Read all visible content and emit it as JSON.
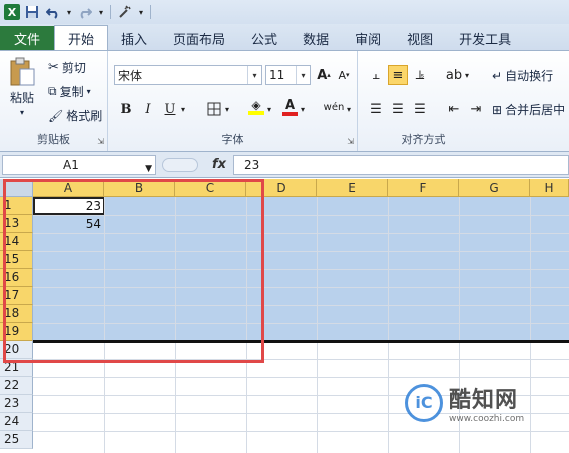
{
  "qat": {
    "app_icon": "X",
    "icons": [
      "save-icon",
      "undo-icon",
      "redo-icon",
      "customize-icon"
    ]
  },
  "tabs": [
    {
      "label": "文件"
    },
    {
      "label": "开始"
    },
    {
      "label": "插入"
    },
    {
      "label": "页面布局"
    },
    {
      "label": "公式"
    },
    {
      "label": "数据"
    },
    {
      "label": "审阅"
    },
    {
      "label": "视图"
    },
    {
      "label": "开发工具"
    }
  ],
  "ribbon": {
    "clipboard": {
      "paste": "粘贴",
      "cut": "剪切",
      "copy": "复制",
      "format_painter": "格式刷",
      "label": "剪贴板"
    },
    "font": {
      "font_name": "宋体",
      "font_size": "11",
      "bold": "B",
      "italic": "I",
      "underline": "U",
      "label": "字体"
    },
    "alignment": {
      "wrap_text": "自动换行",
      "merge_center": "合并后居中",
      "label": "对齐方式"
    }
  },
  "formula_bar": {
    "name_box": "A1",
    "fx": "fx",
    "value": "23"
  },
  "columns": [
    "A",
    "B",
    "C",
    "D",
    "E",
    "F",
    "G",
    "H"
  ],
  "rows": [
    "1",
    "13",
    "14",
    "15",
    "16",
    "17",
    "18",
    "19",
    "20",
    "21",
    "22",
    "23",
    "24",
    "25"
  ],
  "cells": {
    "a1": "23",
    "a13": "54"
  },
  "watermark": {
    "brand": "酷知网",
    "url": "www.coozhi.com"
  },
  "colors": {
    "accent_header": "#f8d66a",
    "selection": "#b9d1ec",
    "file_tab": "#2c7a3d",
    "highlight_box": "#e04848"
  }
}
